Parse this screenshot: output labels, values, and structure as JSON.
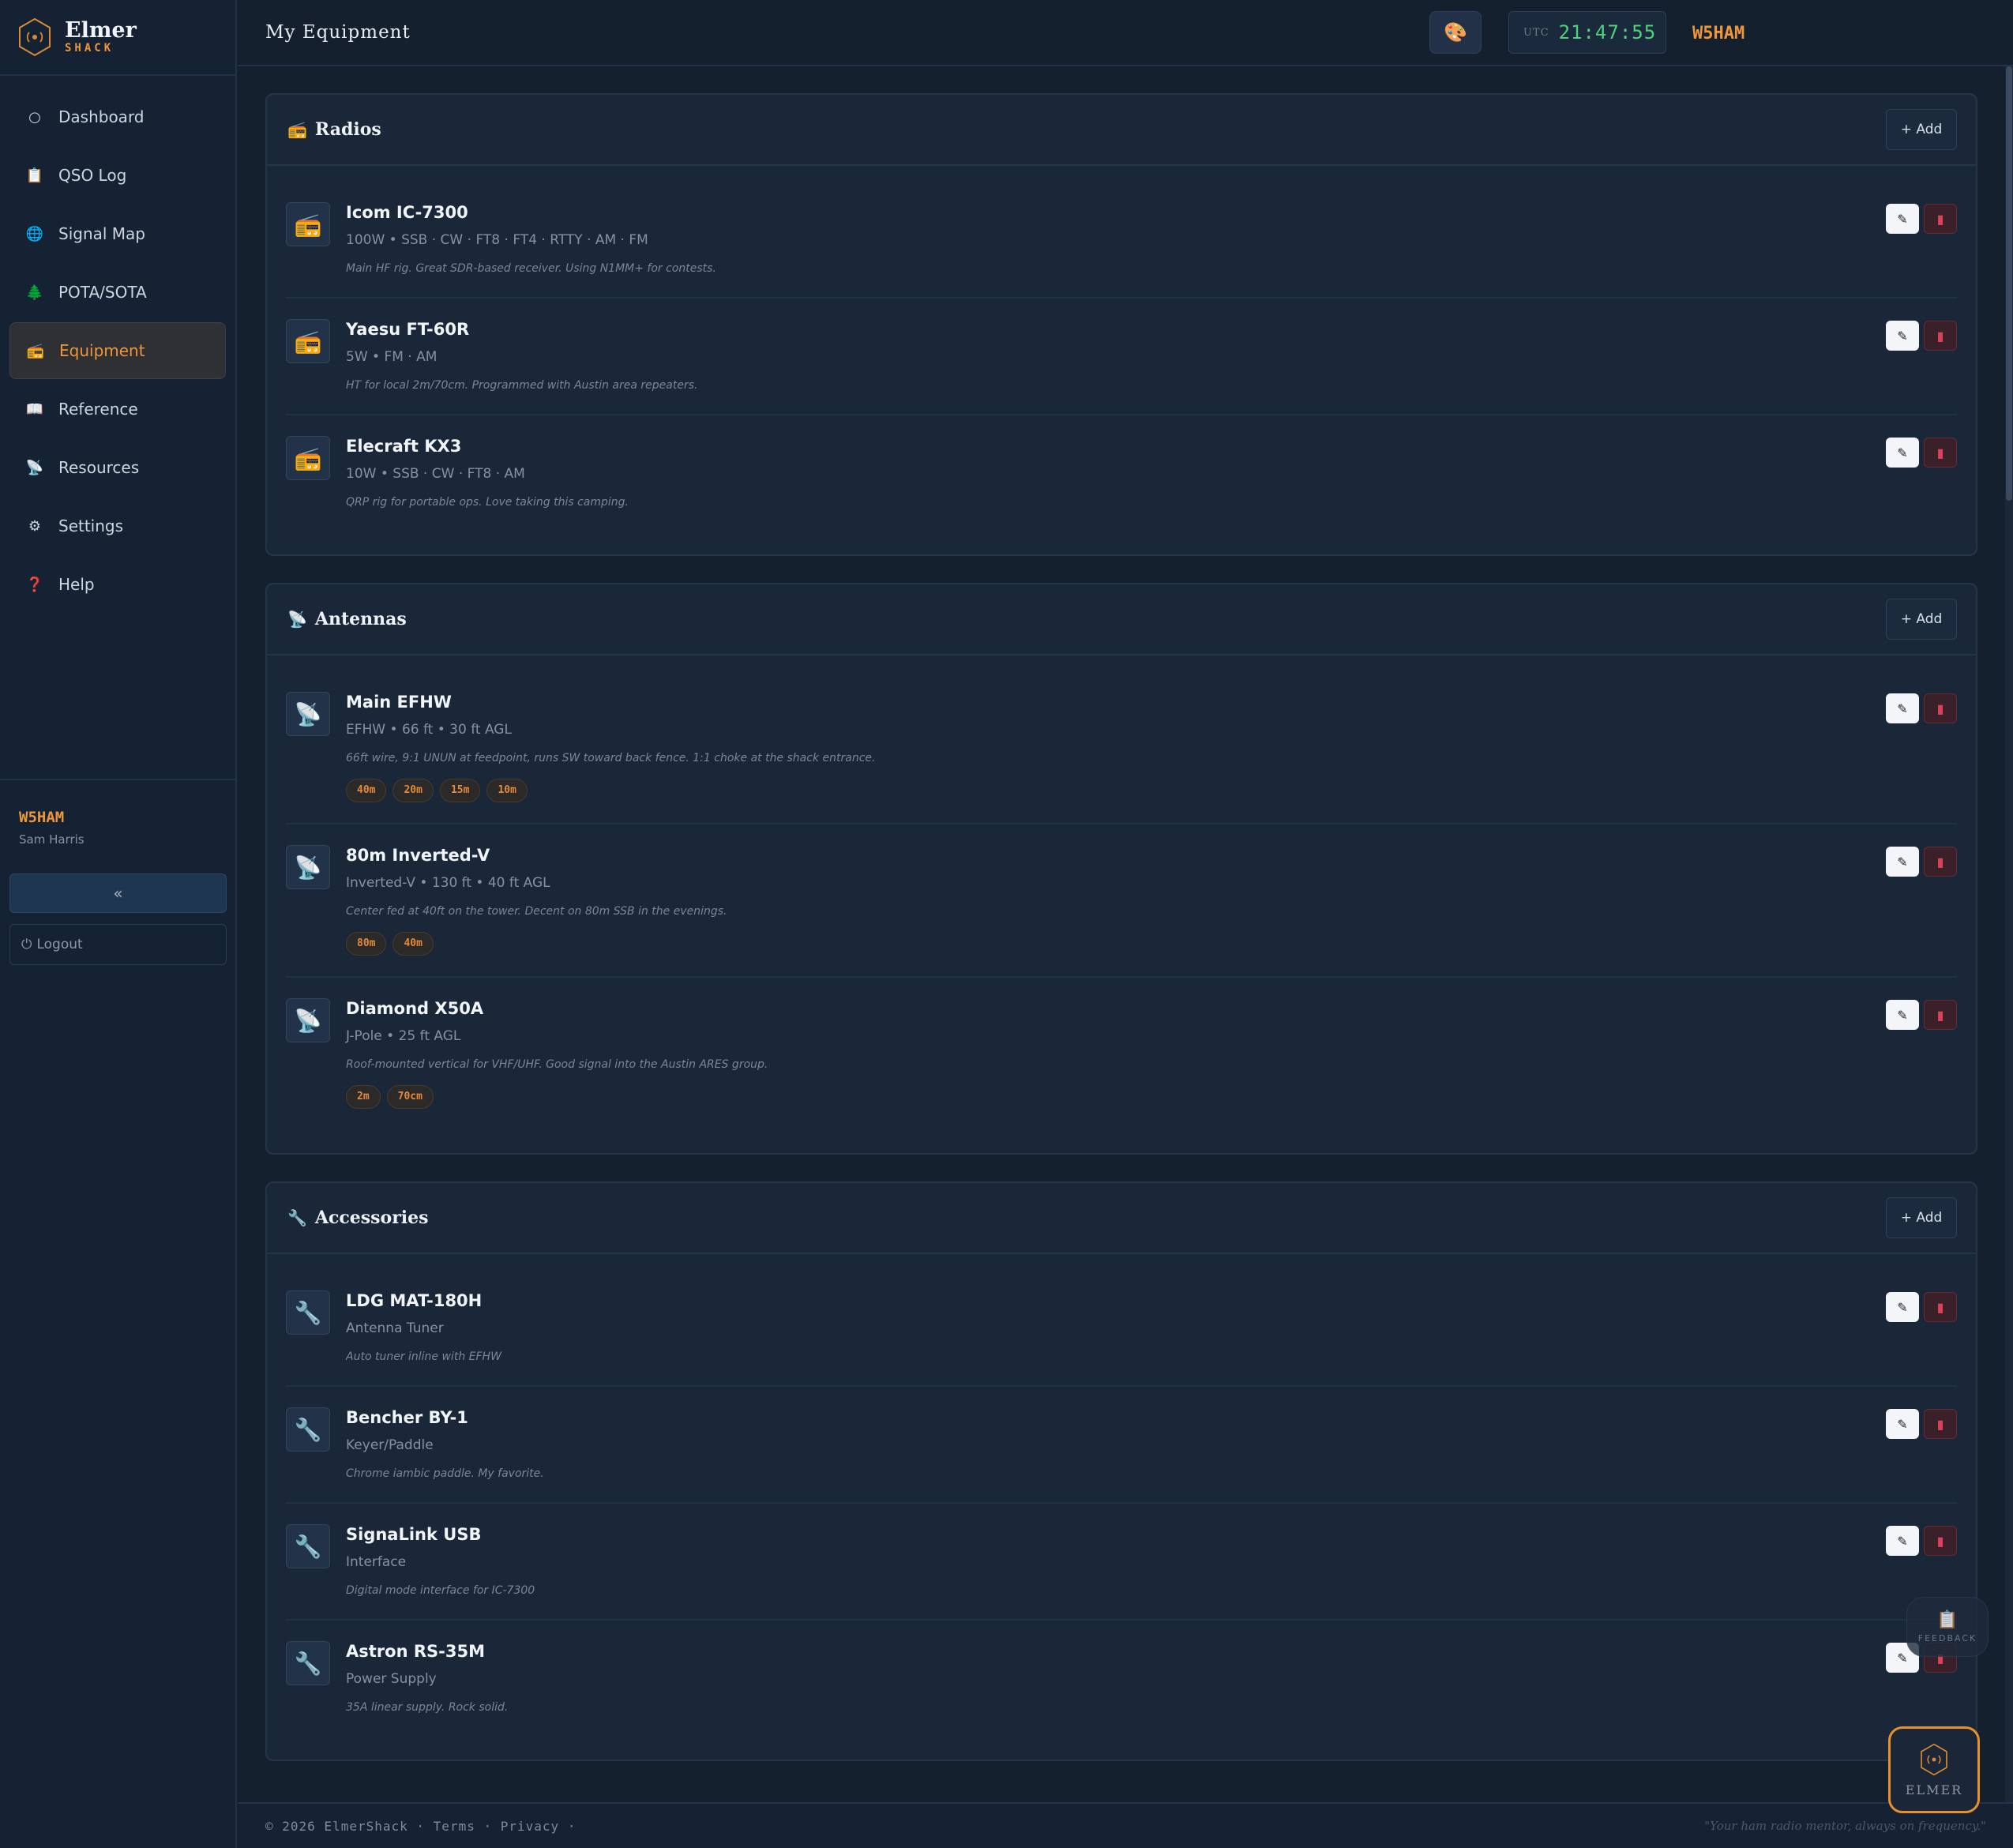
{
  "app": {
    "name": "Elmer",
    "sub": "SHACK"
  },
  "nav": [
    {
      "label": "Dashboard",
      "icon": "○"
    },
    {
      "label": "QSO Log",
      "icon": "📋"
    },
    {
      "label": "Signal Map",
      "icon": "🌐"
    },
    {
      "label": "POTA/SOTA",
      "icon": "🌲"
    },
    {
      "label": "Equipment",
      "icon": "📻"
    },
    {
      "label": "Reference",
      "icon": "📖"
    },
    {
      "label": "Resources",
      "icon": "📡"
    },
    {
      "label": "Settings",
      "icon": "⚙"
    },
    {
      "label": "Help",
      "icon": "❓"
    }
  ],
  "user": {
    "callsign": "W5HAM",
    "name": "Sam Harris"
  },
  "sidebar": {
    "collapse": "«",
    "logout": "Logout"
  },
  "header": {
    "title": "My Equipment",
    "utc_label": "UTC",
    "time": "21:47:55",
    "callsign": "W5HAM"
  },
  "sections": {
    "radios": {
      "title": "Radios",
      "add": "+ Add",
      "items": [
        {
          "name": "Icom IC-7300",
          "spec": "100W • SSB · CW · FT8 · FT4 · RTTY · AM · FM",
          "note": "Main HF rig. Great SDR-based receiver. Using N1MM+ for contests."
        },
        {
          "name": "Yaesu FT-60R",
          "spec": "5W • FM · AM",
          "note": "HT for local 2m/70cm. Programmed with Austin area repeaters."
        },
        {
          "name": "Elecraft KX3",
          "spec": "10W • SSB · CW · FT8 · AM",
          "note": "QRP rig for portable ops. Love taking this camping."
        }
      ]
    },
    "antennas": {
      "title": "Antennas",
      "add": "+ Add",
      "items": [
        {
          "name": "Main EFHW",
          "spec": "EFHW • 66 ft • 30 ft AGL",
          "note": "66ft wire, 9:1 UNUN at feedpoint, runs SW toward back fence. 1:1 choke at the shack entrance.",
          "tags": [
            "40m",
            "20m",
            "15m",
            "10m"
          ]
        },
        {
          "name": "80m Inverted-V",
          "spec": "Inverted-V • 130 ft • 40 ft AGL",
          "note": "Center fed at 40ft on the tower. Decent on 80m SSB in the evenings.",
          "tags": [
            "80m",
            "40m"
          ]
        },
        {
          "name": "Diamond X50A",
          "spec": "J-Pole • 25 ft AGL",
          "note": "Roof-mounted vertical for VHF/UHF. Good signal into the Austin ARES group.",
          "tags": [
            "2m",
            "70cm"
          ]
        }
      ]
    },
    "accessories": {
      "title": "Accessories",
      "add": "+ Add",
      "items": [
        {
          "name": "LDG MAT-180H",
          "spec": "Antenna Tuner",
          "note": "Auto tuner inline with EFHW"
        },
        {
          "name": "Bencher BY-1",
          "spec": "Keyer/Paddle",
          "note": "Chrome iambic paddle. My favorite."
        },
        {
          "name": "SignaLink USB",
          "spec": "Interface",
          "note": "Digital mode interface for IC-7300"
        },
        {
          "name": "Astron RS-35M",
          "spec": "Power Supply",
          "note": "35A linear supply. Rock solid."
        }
      ]
    }
  },
  "footer": {
    "copyright": "© 2026 ElmerShack",
    "terms": "Terms",
    "privacy": "Privacy",
    "tagline": "\"Your ham radio mentor, always on frequency.\""
  },
  "floating": {
    "feedback": "FEEDBACK",
    "elmer": "ELMER"
  },
  "colors": {
    "accent": "#f0963a",
    "clock": "#4fd27a",
    "danger": "#d9425a"
  }
}
